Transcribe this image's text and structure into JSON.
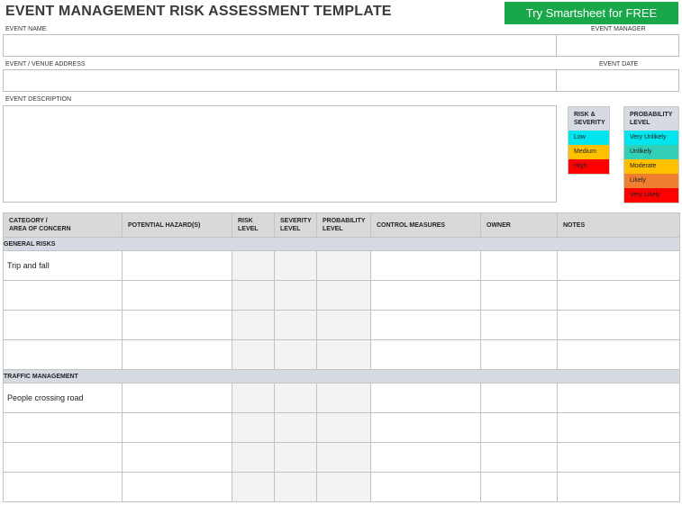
{
  "title": "EVENT MANAGEMENT RISK ASSESSMENT TEMPLATE",
  "cta": "Try Smartsheet for FREE",
  "fields": {
    "event_name": "EVENT NAME",
    "event_manager": "EVENT MANAGER",
    "venue_address": "EVENT / VENUE ADDRESS",
    "event_date": "EVENT DATE",
    "description": "EVENT DESCRIPTION"
  },
  "legend_risk": {
    "header": [
      "RISK &",
      "SEVERITY"
    ],
    "items": [
      {
        "label": "Low",
        "color": "#00e5ee"
      },
      {
        "label": "Medium",
        "color": "#ffc000"
      },
      {
        "label": "High",
        "color": "#ff0000"
      }
    ]
  },
  "legend_prob": {
    "header": [
      "PROBABILITY",
      "LEVEL"
    ],
    "items": [
      {
        "label": "Very Unlikely",
        "color": "#00e5ee"
      },
      {
        "label": "Unlikely",
        "color": "#33d0b8"
      },
      {
        "label": "Moderate",
        "color": "#ffc000"
      },
      {
        "label": "Likely",
        "color": "#f08030"
      },
      {
        "label": "Very Likely",
        "color": "#ff0000"
      }
    ]
  },
  "table": {
    "headers": [
      [
        "CATEGORY /",
        "AREA OF CONCERN"
      ],
      [
        "POTENTIAL HAZARD(S)",
        ""
      ],
      [
        "RISK",
        "LEVEL"
      ],
      [
        "SEVERITY",
        "LEVEL"
      ],
      [
        "PROBABILITY",
        "LEVEL"
      ],
      [
        "CONTROL MEASURES",
        ""
      ],
      [
        "OWNER",
        ""
      ],
      [
        "NOTES",
        ""
      ]
    ],
    "sections": [
      {
        "name": "GENERAL RISKS",
        "rows": [
          "Trip and fall",
          "",
          "",
          ""
        ]
      },
      {
        "name": "TRAFFIC MANAGEMENT",
        "rows": [
          "People crossing road",
          "",
          "",
          ""
        ]
      }
    ]
  }
}
